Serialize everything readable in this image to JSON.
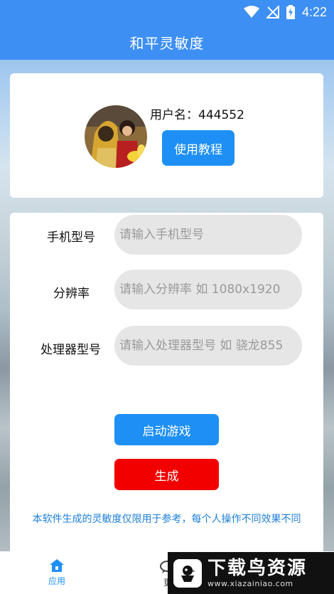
{
  "status_bar": {
    "time": "4:22"
  },
  "header": {
    "title": "和平灵敏度"
  },
  "profile": {
    "username": "用户名：444552",
    "tutorial_button": "使用教程"
  },
  "form": {
    "rows": [
      {
        "label": "手机型号",
        "placeholder": "请输入手机型号"
      },
      {
        "label": "分辨率",
        "placeholder": "请输入分辨率 如 1080x1920"
      },
      {
        "label": "处理器型号",
        "placeholder": "请输入处理器型号 如 骁龙855"
      }
    ],
    "start_button": "启动游戏",
    "generate_button": "生成",
    "notice": "本软件生成的灵敏度仅限用于参考，每个人操作不同效果不同"
  },
  "bottom_nav": {
    "items": [
      {
        "label": "应用",
        "icon": "home-icon"
      },
      {
        "label": "更",
        "icon": "chat-icon"
      }
    ]
  },
  "watermark": {
    "text": "下载鸟资源",
    "url": "www.xiazainiao.com"
  },
  "colors": {
    "primary": "#3d8ff3",
    "button_blue": "#1e90f5",
    "button_red": "#f20000",
    "notice": "#1e7fd8"
  }
}
